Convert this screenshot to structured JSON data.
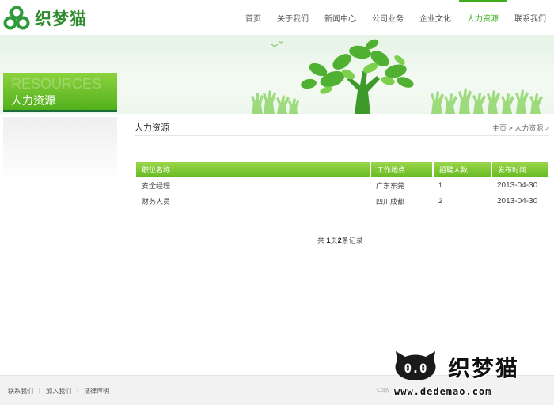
{
  "header": {
    "logo_text": "织梦猫",
    "nav": [
      {
        "label": "首页",
        "active": false
      },
      {
        "label": "关于我们",
        "active": false
      },
      {
        "label": "新闻中心",
        "active": false
      },
      {
        "label": "公司业务",
        "active": false
      },
      {
        "label": "企业文化",
        "active": false
      },
      {
        "label": "人力资源",
        "active": true
      },
      {
        "label": "联系我们",
        "active": false
      }
    ]
  },
  "banner": {
    "section_en": "RESOURCES",
    "section_zh": "人力资源",
    "accent_color": "#5cb82a",
    "stripe_color": "#1d6c3b"
  },
  "content": {
    "title": "人力资源",
    "breadcrumb": "主页 > 人力资源 >"
  },
  "jobs_table": {
    "headers": [
      "职位名称",
      "工作地点",
      "招聘人数",
      "发布时间"
    ],
    "rows": [
      [
        "安全经理",
        "广东东莞",
        "1",
        "2013-04-30"
      ],
      [
        "财务人员",
        "四川成都",
        "2",
        "2013-04-30"
      ]
    ]
  },
  "pager": {
    "prefix": "共",
    "pages": "1",
    "middle": "页",
    "records": "2",
    "suffix": "条记录"
  },
  "footer": {
    "links": [
      "联系我们",
      "加入我们",
      "法律声明"
    ],
    "separator": "|",
    "copyright": "Copy"
  },
  "watermark": {
    "brand": "织梦猫",
    "url": "www.dedemao.com",
    "cat_eyes": "0.0"
  },
  "icons": {
    "logo": "trefoil-logo-icon",
    "watermark": "cat-face-icon"
  }
}
